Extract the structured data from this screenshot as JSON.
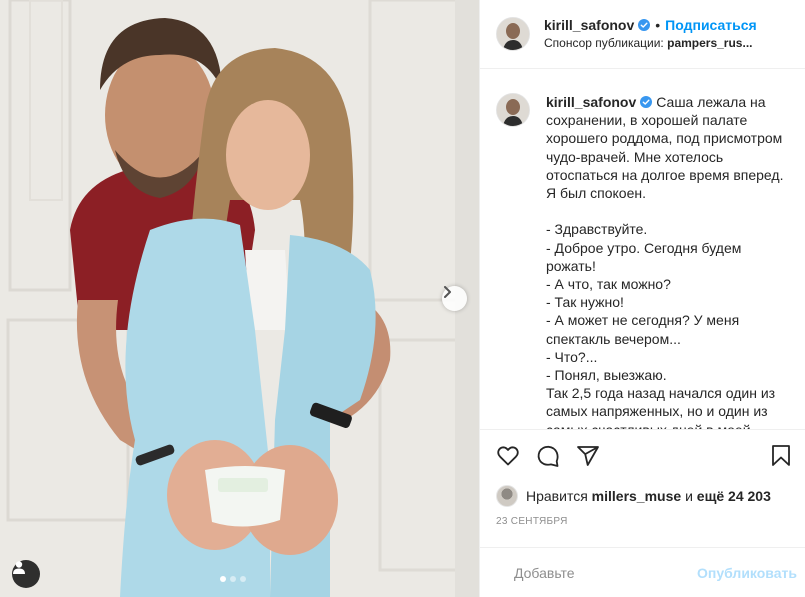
{
  "post": {
    "media": {
      "photo_description_icon": "photo",
      "next_icon": "chevron-right-icon",
      "tags_icon": "user-tag-icon",
      "slide_count": 3,
      "active_slide": 1
    },
    "header": {
      "username": "kirill_safonov",
      "separator": "•",
      "follow_label": "Подписаться",
      "sponsor_prefix": "Спонсор публикации:",
      "sponsor_name": "pampers_rus...",
      "verified_color": "#3897f0"
    },
    "caption": {
      "username": "kirill_safonov",
      "text": "Саша лежала на сохранении, в хорошей палате хорошего роддома, под присмотром чудо-врачей. Мне хотелось отоспаться на долгое время вперед. Я был спокоен.\n\n- Здравствуйте.\n- Доброе утро. Сегодня будем рожать!\n- А что, так можно?\n- Так нужно!\n- А может не сегодня? У меня спектакль вечером...\n- Что?...\n- Понял, выезжаю.\nТак 2,5 года назад начался один из самых напряженных, но и один из самых счастливых дней в моей жизни."
    },
    "actions": {
      "like_icon": "heart-icon",
      "comment_icon": "comment-icon",
      "share_icon": "share-icon",
      "save_icon": "bookmark-icon"
    },
    "likes": {
      "prefix": "Нравится",
      "user": "millers_muse",
      "middle": "и",
      "rest": "ещё 24 203"
    },
    "date": "23 СЕНТЯБРЯ",
    "comment_box": {
      "placeholder": "Добавьте комментарий...",
      "placeholder_visible": "Добавьте",
      "post_label": "Опубликовать"
    },
    "colors": {
      "link": "#0095f6",
      "post_disabled": "#b2dffc",
      "muted": "#8e8e8e"
    }
  }
}
